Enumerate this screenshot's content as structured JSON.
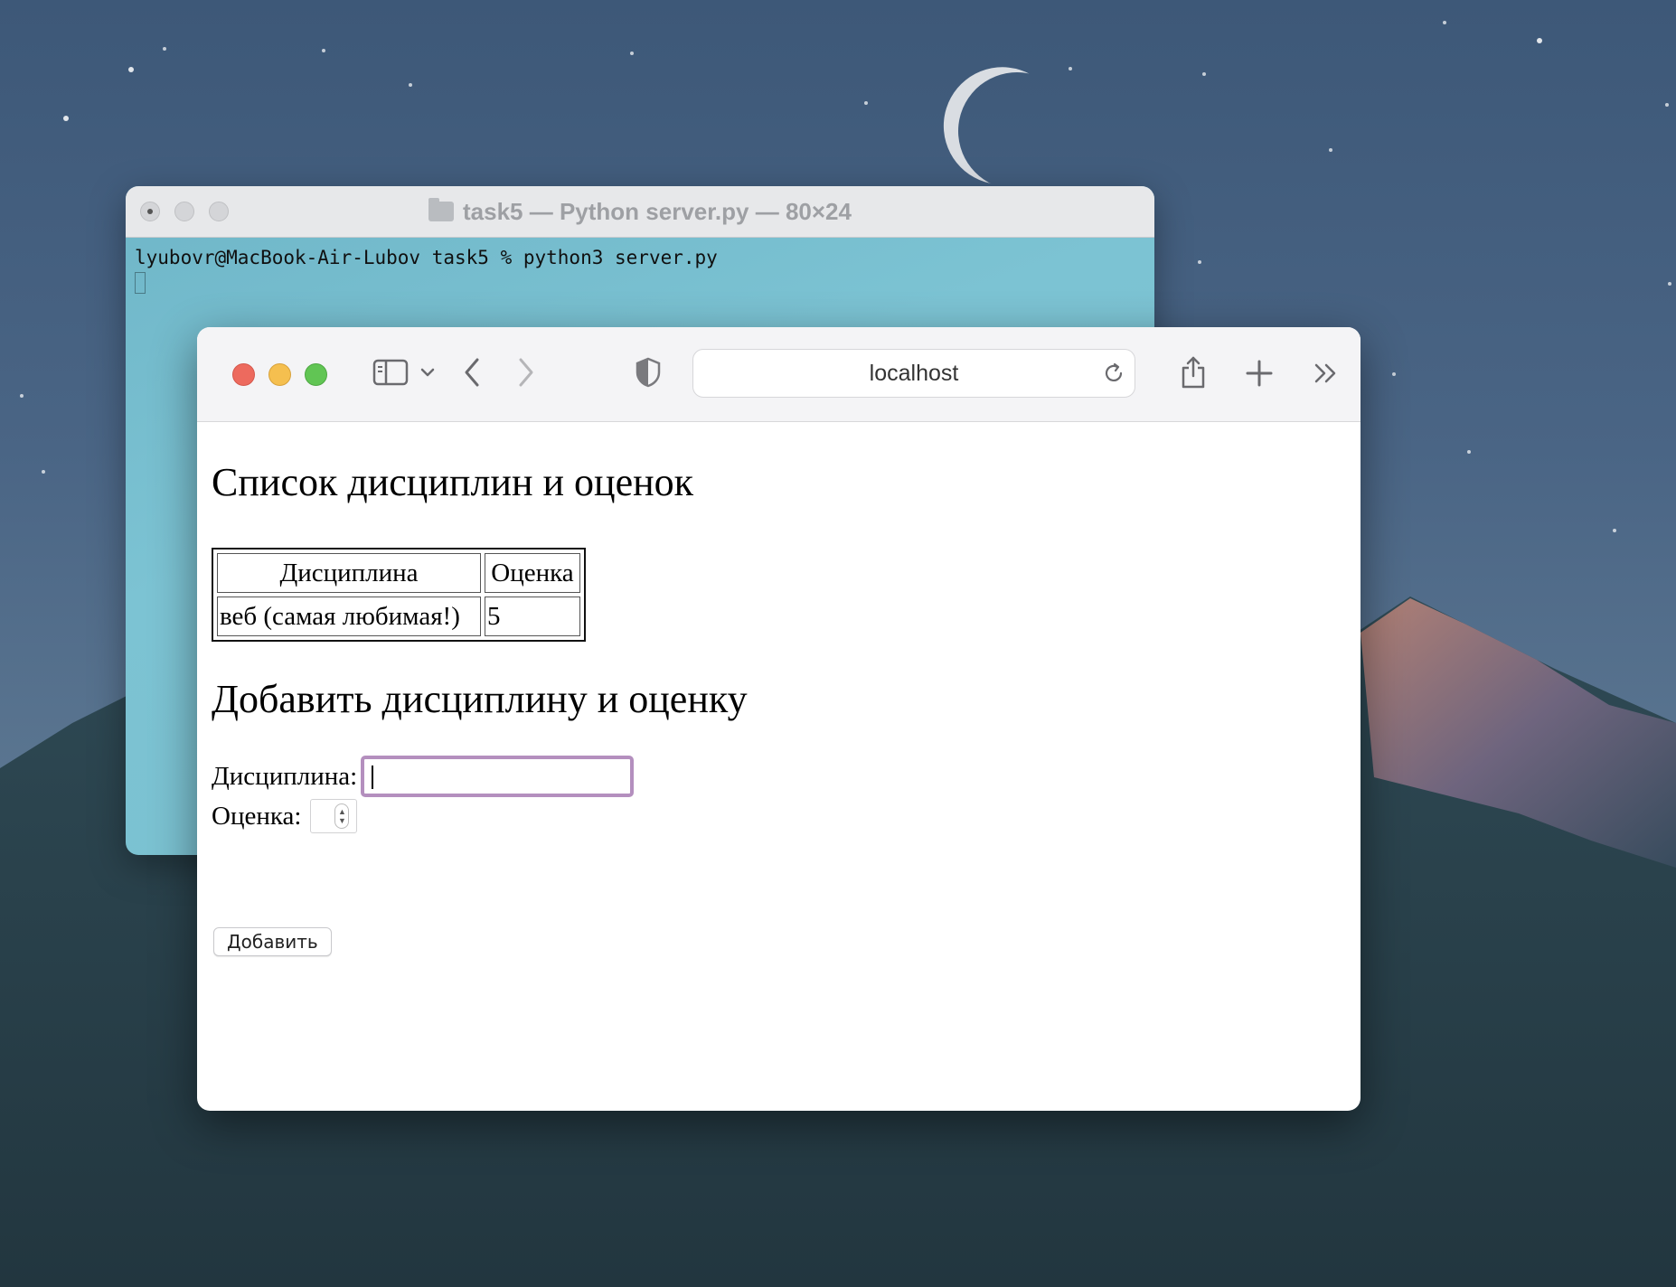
{
  "terminal": {
    "title": "task5 — Python server.py — 80×24",
    "command_line": "lyubovr@MacBook-Air-Lubov task5 % python3 server.py"
  },
  "browser": {
    "address": "localhost"
  },
  "page": {
    "list_heading": "Список дисциплин и оценок",
    "table": {
      "headers": [
        "Дисциплина",
        "Оценка"
      ],
      "rows": [
        [
          "веб (самая любимая!)",
          "5"
        ]
      ]
    },
    "add_heading": "Добавить дисциплину и оценку",
    "form": {
      "discipline_label": "Дисциплина:",
      "discipline_value": "",
      "grade_label": "Оценка:",
      "grade_value": "",
      "submit_label": "Добавить"
    }
  }
}
